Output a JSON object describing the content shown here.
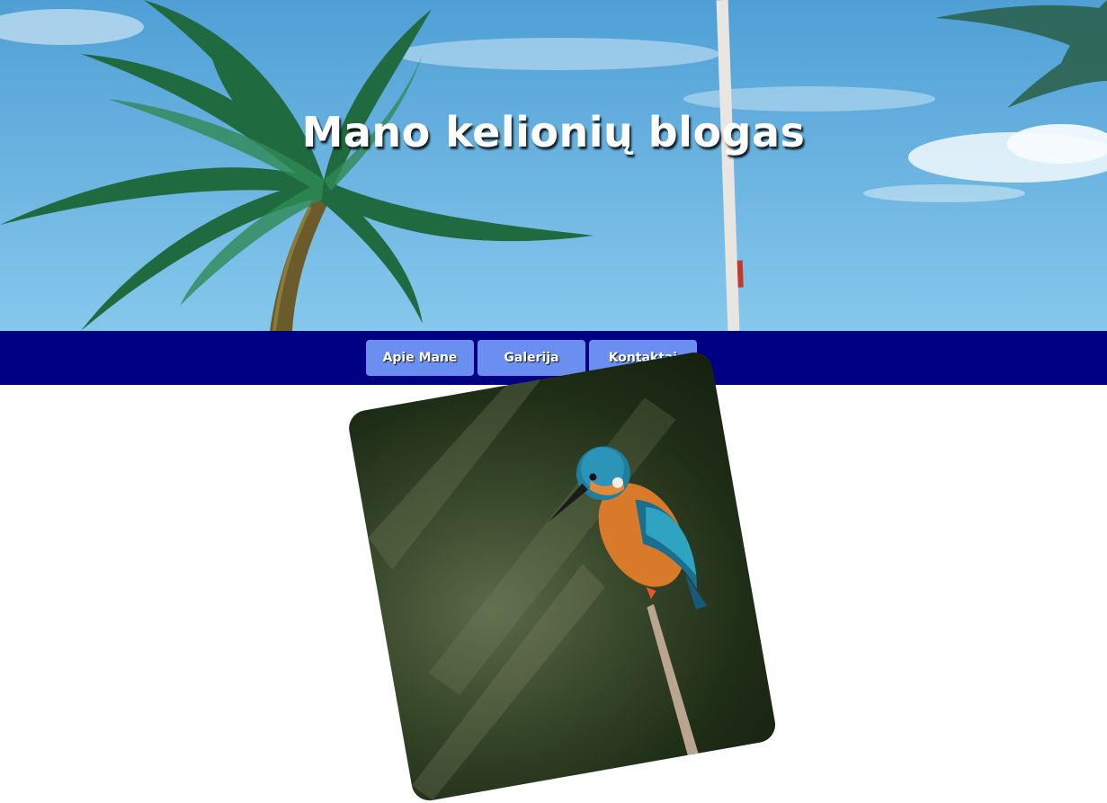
{
  "hero": {
    "title": "Mano kelionių blogas",
    "image": "palm-trees-sky-photo"
  },
  "nav": {
    "items": [
      {
        "label": "Apie Mane"
      },
      {
        "label": "Galerija"
      },
      {
        "label": "Kontaktai"
      }
    ]
  },
  "gallery": {
    "photo": "kingfisher-bird-photo"
  },
  "colors": {
    "nav_bg": "#000084",
    "button_bg": "#6b8ff0",
    "title_text": "#ffffff"
  }
}
